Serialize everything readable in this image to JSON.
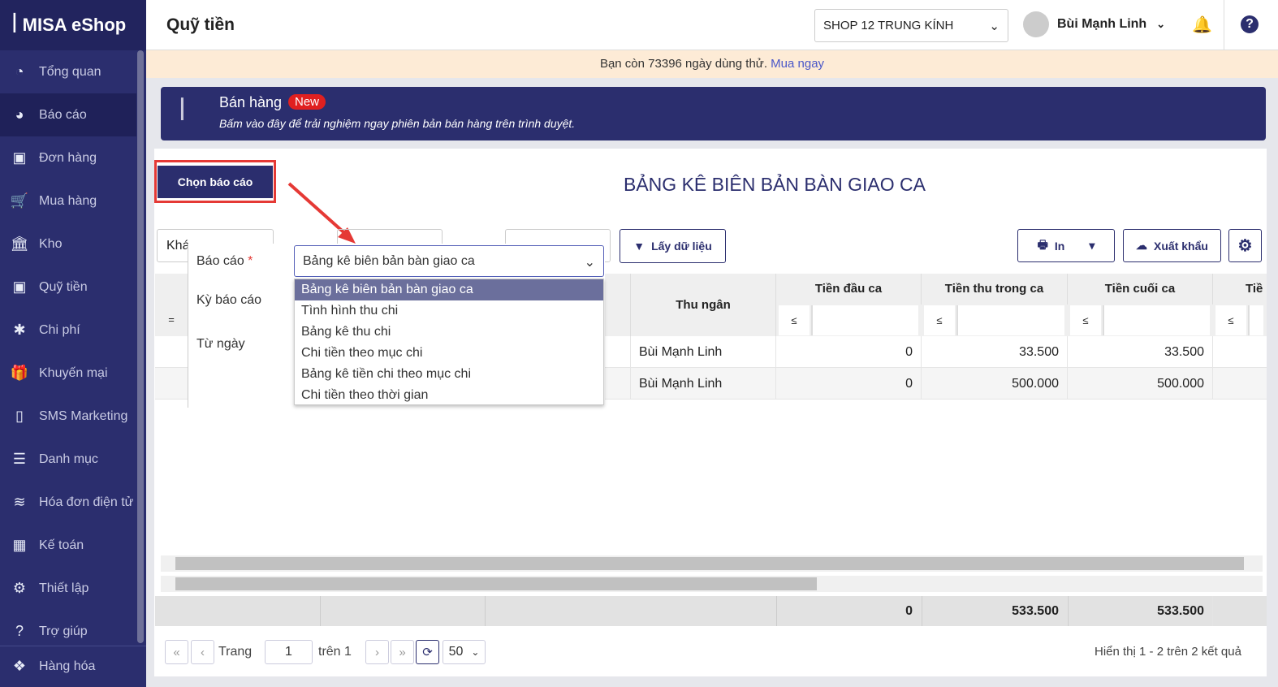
{
  "app": {
    "logo": "MISA eShop",
    "page_title": "Quỹ tiền"
  },
  "sidebar": {
    "items": [
      {
        "label": "Tổng quan",
        "icon": "dashboard-icon"
      },
      {
        "label": "Báo cáo",
        "icon": "pie-chart-icon"
      },
      {
        "label": "Đơn hàng",
        "icon": "order-icon"
      },
      {
        "label": "Mua hàng",
        "icon": "cart-icon"
      },
      {
        "label": "Kho",
        "icon": "warehouse-icon"
      },
      {
        "label": "Quỹ tiền",
        "icon": "safe-icon"
      },
      {
        "label": "Chi phí",
        "icon": "money-icon"
      },
      {
        "label": "Khuyến mại",
        "icon": "gift-icon"
      },
      {
        "label": "SMS Marketing",
        "icon": "phone-icon"
      },
      {
        "label": "Danh mục",
        "icon": "list-icon"
      },
      {
        "label": "Hóa đơn điện tử",
        "icon": "invoice-icon"
      },
      {
        "label": "Kế toán",
        "icon": "calculator-icon"
      },
      {
        "label": "Thiết lập",
        "icon": "gear-icon"
      },
      {
        "label": "Trợ giúp",
        "icon": "help-icon"
      },
      {
        "label": "Hàng hóa",
        "icon": "boxes-icon"
      }
    ]
  },
  "header": {
    "shop": "SHOP 12 TRUNG KÍNH",
    "user": "Bùi Mạnh Linh"
  },
  "trial": {
    "text": "Bạn còn 73396 ngày dùng thử.",
    "link": "Mua ngay"
  },
  "promo": {
    "title": "Bán hàng",
    "badge": "New",
    "subtitle": "Bấm vào đây để trải nghiệm ngay phiên bản bán hàng trên trình duyệt."
  },
  "report": {
    "choose_button": "Chọn báo cáo",
    "title": "BẢNG KÊ BIÊN BẢN BÀN GIAO CA",
    "filter_partial": "Khá",
    "get_data": "Lấy dữ liệu",
    "print": "In",
    "export": "Xuất khẩu"
  },
  "popup": {
    "report_label": "Báo cáo",
    "required": "*",
    "period_label": "Kỳ báo cáo",
    "from_label": "Từ ngày",
    "selected": "Bảng kê biên bản bàn giao ca",
    "options": [
      "Bảng kê biên bản bàn giao ca",
      "Tình hình thu chi",
      "Bảng kê thu chi",
      "Chi tiền theo mục chi",
      "Bảng kê tiền chi theo mục chi",
      "Chi tiền theo thời gian"
    ]
  },
  "table": {
    "columns": [
      "Thu ngân",
      "Tiền đầu ca",
      "Tiền thu trong ca",
      "Tiền cuối ca",
      "Tiề"
    ],
    "filter_eq": "=",
    "filter_le": "≤",
    "rows": [
      [
        "Bùi Mạnh Linh",
        "0",
        "33.500",
        "33.500"
      ],
      [
        "Bùi Mạnh Linh",
        "0",
        "500.000",
        "500.000"
      ]
    ],
    "totals": [
      "0",
      "533.500",
      "533.500"
    ]
  },
  "pager": {
    "page_label": "Trang",
    "page": "1",
    "of": "trên 1",
    "page_size": "50",
    "summary": "Hiển thị 1 - 2 trên 2 kết quả"
  }
}
